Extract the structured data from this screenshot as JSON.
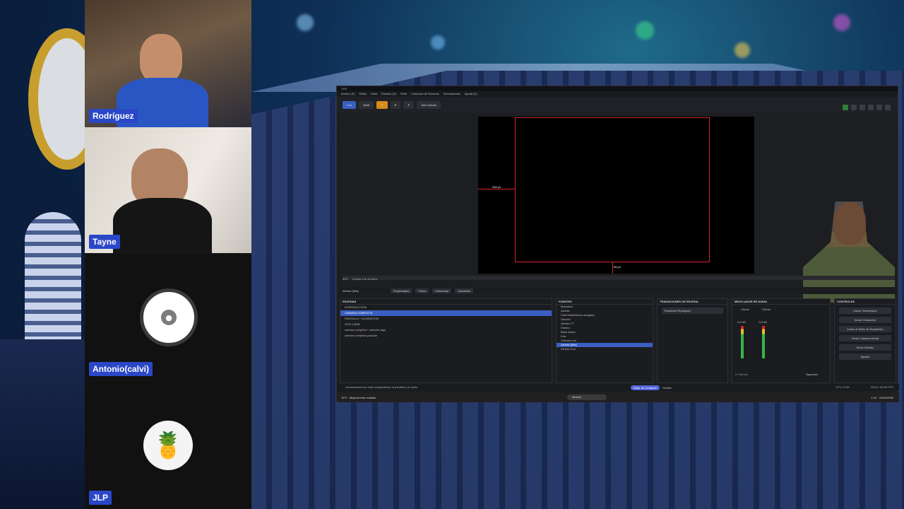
{
  "participants": [
    {
      "name": "Rodríguez",
      "avatar": "camera-feed"
    },
    {
      "name": "Tayne",
      "avatar": "camera-feed"
    },
    {
      "name": "Antonio(calvi)",
      "avatar": "person-icon"
    },
    {
      "name": "JLP",
      "avatar": "pineapple-image"
    }
  ],
  "obs": {
    "menu": [
      "Archivo (F)",
      "Editar",
      "Vista",
      "Paneles (D)",
      "Perfil",
      "Colección de Escenas",
      "Herramientas",
      "Ayuda (H)"
    ],
    "toolbar": {
      "live": "Live",
      "build": "Build",
      "add_canvas": "Add Canvas"
    },
    "preview": {
      "left_label": "265 px",
      "bottom_label": "65 px",
      "zoom": "85%",
      "fit": "Ajustar a la ventana"
    },
    "source_row": {
      "selected": "Alertas (Bits)",
      "properties": "Propiedades",
      "filters": "Filtros",
      "interact": "Interactuar",
      "refresh": "Actualizar"
    },
    "docks": {
      "scenes_title": "ESCENAS",
      "sources_title": "FUENTES",
      "transitions_title": "TRANSICIONES DE ESCENA",
      "mixer_title": "MEZCLADOR DE AUDIO",
      "controls_title": "CONTROLES"
    },
    "scenes": [
      "INTRODUCCION",
      "CAMARA COMPLETA",
      "PANTALLA + ALINEACION",
      "SOS CAMB",
      "camara completa + estuche algo",
      "camara completa youtube"
    ],
    "sources": [
      "Marcador",
      "Alertas",
      "Chat MultiStream anegado",
      "Discord",
      "Alertas YT",
      "Directo",
      "Base trama",
      "Kick",
      "Cámara Iron",
      "Alertas (Bits)",
      "Alertas Kick"
    ],
    "transition": "Transición Rodríguez",
    "mixer": {
      "ch1": "Global",
      "ch2": "Global",
      "ch1_db": "-6.5 dB",
      "ch2_db": "-3.6 dB",
      "footer_left": "0 Fuentes",
      "options": "Opciones"
    },
    "controls": [
      "Iniciar Transmisión",
      "Iniciar Grabación",
      "Iniciar el Búfer de Repetición",
      "Iniciar Cámara Virtual",
      "Modo Estudio",
      "Ajustes"
    ],
    "share": {
      "notice": "riversurekatt.com está compartiendo la pantalla y el audio.",
      "stop": "Dejar de compartir",
      "hide": "Ocultar"
    },
    "status": {
      "cpu": "CPU: 0.9%",
      "fps": "00:00 / 60.00 FPS"
    },
    "taskbar": {
      "weather_temp": "19°C",
      "weather_desc": "Mayormente nublado",
      "search": "Buscar",
      "time": "1:44",
      "date": "22/04/2026"
    }
  }
}
